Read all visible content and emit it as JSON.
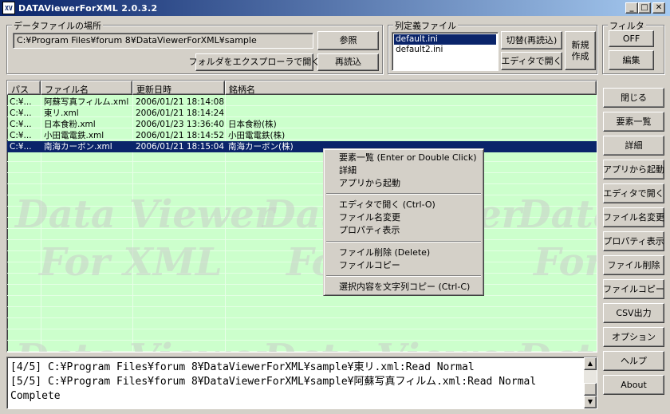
{
  "window": {
    "title": "DATAViewerForXML 2.0.3.2",
    "icon_text": "XV"
  },
  "data_folder": {
    "label": "データファイルの場所",
    "path": "C:¥Program Files¥forum 8¥DataViewerForXML¥sample",
    "browse_button": "参照",
    "open_explorer_button": "フォルダをエクスプローラで開く",
    "reload_button": "再読込"
  },
  "column_def": {
    "label": "列定義ファイル",
    "files": [
      "default.ini",
      "default2.ini"
    ],
    "switch_button": "切替(再読込)",
    "open_editor_button": "エディタで開く",
    "new_button_line1": "新規",
    "new_button_line2": "作成"
  },
  "filter": {
    "label": "フィルタ",
    "toggle_button": "OFF",
    "edit_button": "編集"
  },
  "list": {
    "headers": [
      "パス",
      "ファイル名",
      "更新日時",
      "銘柄名"
    ],
    "rows": [
      {
        "path": "C:¥...",
        "file": "阿蘇写真フィルム.xml",
        "date": "2006/01/21 18:14:08",
        "name": ""
      },
      {
        "path": "C:¥...",
        "file": "東リ.xml",
        "date": "2006/01/21 18:14:24",
        "name": ""
      },
      {
        "path": "C:¥...",
        "file": "日本食粉.xml",
        "date": "2006/01/23 13:36:40",
        "name": "日本食粉(株)"
      },
      {
        "path": "C:¥...",
        "file": "小田電電鉄.xml",
        "date": "2006/01/21 18:14:52",
        "name": "小田電電鉄(株)"
      },
      {
        "path": "C:¥...",
        "file": "南海カーボン.xml",
        "date": "2006/01/21 18:15:04",
        "name": "南海カーボン(株)"
      }
    ],
    "watermark_line1": "Data Viewer",
    "watermark_line2": "For XML"
  },
  "context_menu": {
    "items": [
      "要素一覧 (Enter or Double Click)",
      "詳細",
      "アプリから起動",
      "エディタで開く (Ctrl-O)",
      "ファイル名変更",
      "プロパティ表示",
      "ファイル削除 (Delete)",
      "ファイルコピー",
      "選択内容を文字列コピー (Ctrl-C)"
    ]
  },
  "sidebar": {
    "buttons": [
      "閉じる",
      "要素一覧",
      "詳細",
      "アプリから起動",
      "エディタで開く",
      "ファイル名変更",
      "プロパティ表示",
      "ファイル削除",
      "ファイルコピー",
      "CSV出力",
      "オプション",
      "ヘルプ",
      "About"
    ]
  },
  "log": {
    "lines": [
      "[4/5] C:¥Program Files¥forum 8¥DataViewerForXML¥sample¥東リ.xml:Read Normal",
      "[5/5] C:¥Program Files¥forum 8¥DataViewerForXML¥sample¥阿蘇写真フィルム.xml:Read Normal",
      "Complete"
    ]
  }
}
